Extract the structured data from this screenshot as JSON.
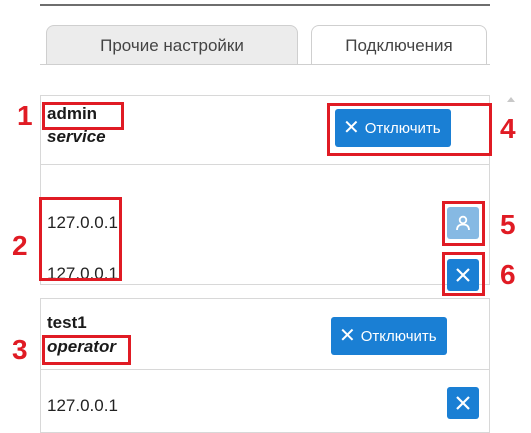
{
  "tabs": [
    {
      "label": "Прочие настройки",
      "active": true
    },
    {
      "label": "Подключения",
      "active": false
    }
  ],
  "sessions": [
    {
      "user": "admin",
      "role": "service",
      "disconnect_label": "Отключить",
      "connections": [
        "127.0.0.1",
        "127.0.0.1"
      ]
    },
    {
      "user": "test1",
      "role": "operator",
      "disconnect_label": "Отключить",
      "connections": [
        "127.0.0.1"
      ]
    }
  ],
  "annotations": [
    "1",
    "2",
    "3",
    "4",
    "5",
    "6"
  ],
  "icons": {
    "disconnect": "close-icon",
    "make_admin": "user-icon",
    "close_connection": "close-icon"
  },
  "colors": {
    "button_blue": "#1a7fd4",
    "button_blue_light": "#86b9e3",
    "annotation_red": "#e01b24"
  }
}
